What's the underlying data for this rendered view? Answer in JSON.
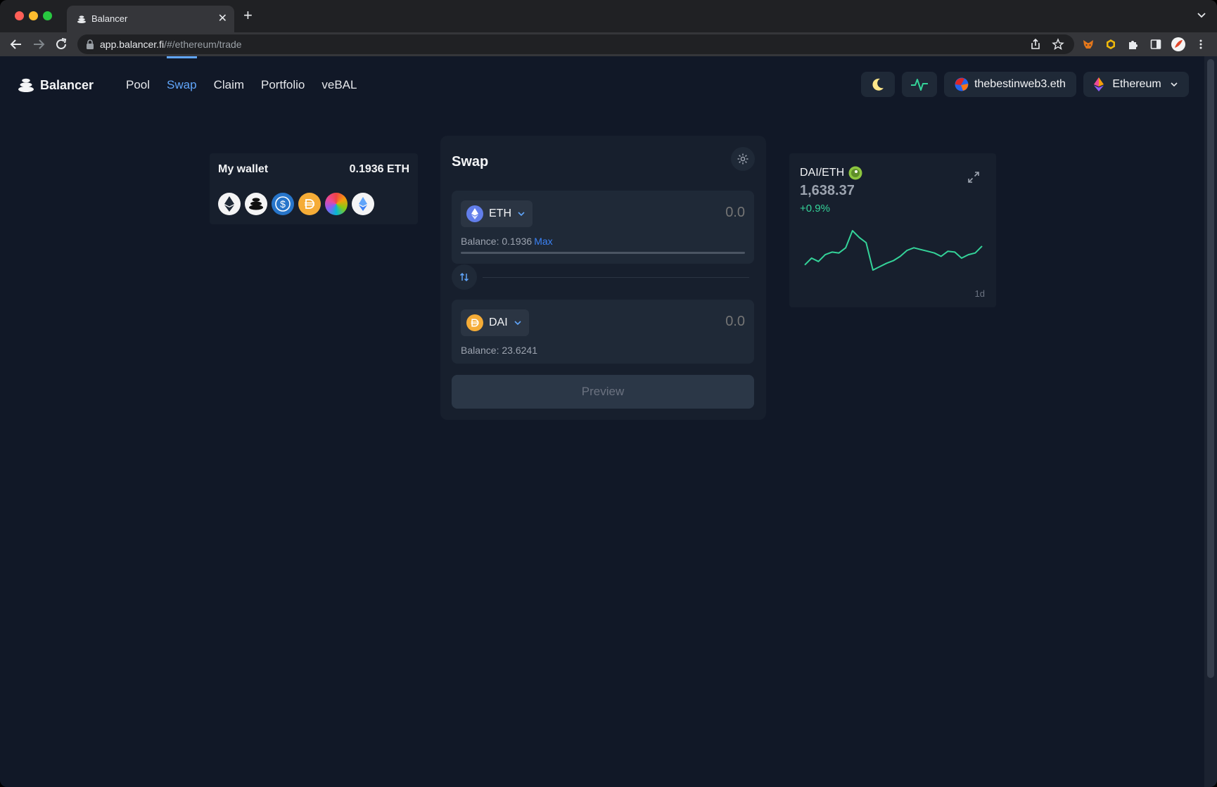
{
  "browser": {
    "tab_title": "Balancer",
    "url_host": "app.balancer.fi",
    "url_path": "/#/ethereum/trade"
  },
  "app": {
    "brand": "Balancer",
    "nav": [
      {
        "label": "Pool"
      },
      {
        "label": "Swap",
        "active": true
      },
      {
        "label": "Claim"
      },
      {
        "label": "Portfolio"
      },
      {
        "label": "veBAL"
      }
    ],
    "account": "thebestinweb3.eth",
    "network": "Ethereum"
  },
  "wallet": {
    "title": "My wallet",
    "balance": "0.1936 ETH",
    "tokens": [
      "eth-icon",
      "bal-icon",
      "usdc-icon",
      "dai-icon",
      "rainbow-token-icon",
      "steth-icon"
    ]
  },
  "swap": {
    "title": "Swap",
    "from": {
      "symbol": "ETH",
      "amount_placeholder": "0.0",
      "balance_label": "Balance: 0.1936",
      "max_label": "Max"
    },
    "to": {
      "symbol": "DAI",
      "amount_placeholder": "0.0",
      "balance_label": "Balance: 23.6241"
    },
    "preview_label": "Preview"
  },
  "price_chart": {
    "pair": "DAI/ETH",
    "price": "1,638.37",
    "change": "+0.9%",
    "period": "1d",
    "line_color": "#34d399",
    "series": [
      30,
      38,
      34,
      42,
      45,
      44,
      50,
      70,
      62,
      56,
      24,
      28,
      32,
      35,
      40,
      47,
      50,
      48,
      46,
      44,
      40,
      46,
      45,
      38,
      42,
      44,
      52
    ]
  }
}
